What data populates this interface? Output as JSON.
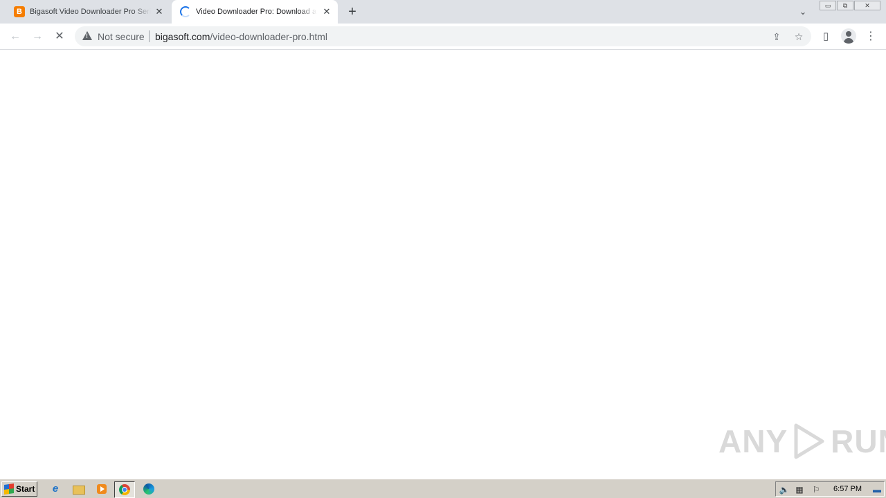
{
  "browser": {
    "tabs": [
      {
        "title": "Bigasoft Video Downloader Pro Serial",
        "favicon": "blogger-icon",
        "active": false
      },
      {
        "title": "Video Downloader Pro: Download and",
        "favicon": "loading-spinner-icon",
        "active": true
      }
    ],
    "new_tab_symbol": "+",
    "tab_close_symbol": "✕",
    "tab_search_symbol": "⌄",
    "window_controls": {
      "minimize": "▭",
      "restore": "⧉",
      "close": "✕"
    }
  },
  "toolbar": {
    "back_symbol": "←",
    "forward_symbol": "→",
    "stop_symbol": "✕",
    "security_label": "Not secure",
    "url_host": "bigasoft.com",
    "url_path": "/video-downloader-pro.html",
    "share_symbol": "⇪",
    "bookmark_symbol": "☆",
    "side_panel_symbol": "▯",
    "menu_symbol": "⋮"
  },
  "watermark": {
    "left": "ANY",
    "right": "RUN"
  },
  "taskbar": {
    "start_label": "Start",
    "clock": "6:57 PM",
    "pinned": [
      "ie-icon",
      "folder-icon",
      "media-player-icon",
      "chrome-icon",
      "edge-icon"
    ]
  },
  "colors": {
    "tabstrip_bg": "#dee1e6",
    "omnibox_bg": "#f1f3f4",
    "taskbar_bg": "#d4d0c8",
    "spinner": "#1a73e8",
    "blogger": "#f57d00"
  }
}
